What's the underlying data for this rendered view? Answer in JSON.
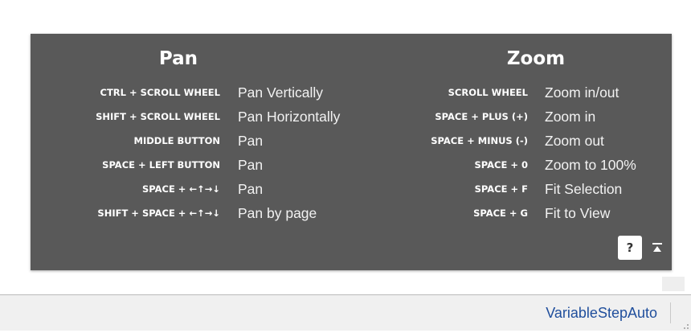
{
  "panel": {
    "pan_title": "Pan",
    "zoom_title": "Zoom",
    "pan_shortcuts": [
      {
        "key": "CTRL + SCROLL WHEEL",
        "action": "Pan Vertically"
      },
      {
        "key": "SHIFT + SCROLL WHEEL",
        "action": "Pan Horizontally"
      },
      {
        "key": "MIDDLE BUTTON",
        "action": "Pan"
      },
      {
        "key": "SPACE + LEFT BUTTON",
        "action": "Pan"
      },
      {
        "key": "SPACE + ←↑→↓",
        "action": "Pan"
      },
      {
        "key": "SHIFT + SPACE + ←↑→↓",
        "action": "Pan by page"
      }
    ],
    "zoom_shortcuts": [
      {
        "key": "SCROLL WHEEL",
        "action": "Zoom in/out"
      },
      {
        "key": "SPACE + PLUS (+)",
        "action": "Zoom in"
      },
      {
        "key": "SPACE + MINUS (-)",
        "action": "Zoom out"
      },
      {
        "key": "SPACE + 0",
        "action": "Zoom to 100%"
      },
      {
        "key": "SPACE + F",
        "action": "Fit Selection"
      },
      {
        "key": "SPACE + G",
        "action": "Fit to View"
      }
    ],
    "help_label": "?",
    "collapse_icon": "collapse-up-icon",
    "background_color": "#595959"
  },
  "status_bar": {
    "text": "VariableStepAuto",
    "text_color": "#1f4e9c"
  }
}
